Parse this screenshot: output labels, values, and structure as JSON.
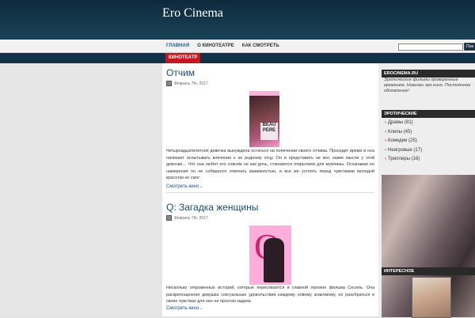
{
  "site": {
    "title": "Ero Cinema"
  },
  "nav": {
    "items": [
      "ГЛАВНАЯ",
      "О КИНОТЕАТРЕ",
      "КАК СМОТРЕТЬ"
    ]
  },
  "search": {
    "button_label": "Пои",
    "placeholder": ""
  },
  "category_tab": "КИНОТЕАТР",
  "posts": [
    {
      "title": "Отчим",
      "date": "Февраль 7th, 2017",
      "poster_text": "BEAU PERE",
      "description": "Четырнадцатилетняя девочка вынуждена остаться на попечении своего отчима. Проходит время и она начинает испытывать влечение к не родному отцу. Он и представить не мог, какие мысли у этой девочки… Что она любит его совсем не как дочь, становится открытием для мужчины. Осознавая ее намерения он не собирался отвечать взаимностью, и все же устоять перед чувствами молодой красотки не смог.",
      "more": "Смотреть кино→"
    },
    {
      "title": "Q: Загадка женщины",
      "date": "Февраль 7th, 2017",
      "poster_text": "Q",
      "description": "Несколько откровенных историй, которые пересекаются в главной героине фильма Сесиль. Она раскрепощенная девушка сексуальные удовольствия каждому новому знакомому, но разобраться в своих чувствах для нее не простая задача.",
      "more": "Смотреть кино→"
    }
  ],
  "sidebar": {
    "about_heading": "EROCINEMA.RU",
    "about_text": "Эротические фильмы проверенные временем. Новинки эро кино. Постоянное обновление!",
    "categories_heading": "ЭРОТИЧЕСКИЕ",
    "categories": [
      {
        "name": "Драмы",
        "count": "(81)"
      },
      {
        "name": "Клипы",
        "count": "(45)"
      },
      {
        "name": "Комедии",
        "count": "(25)"
      },
      {
        "name": "Неигровые",
        "count": "(17)"
      },
      {
        "name": "Триллеры",
        "count": "(16)"
      }
    ],
    "interesting_heading": "ИНТЕРЕСНОЕ"
  },
  "colors": {
    "header": "#0d2a3c",
    "accent": "#c8161c",
    "link": "#1a4a7a"
  }
}
